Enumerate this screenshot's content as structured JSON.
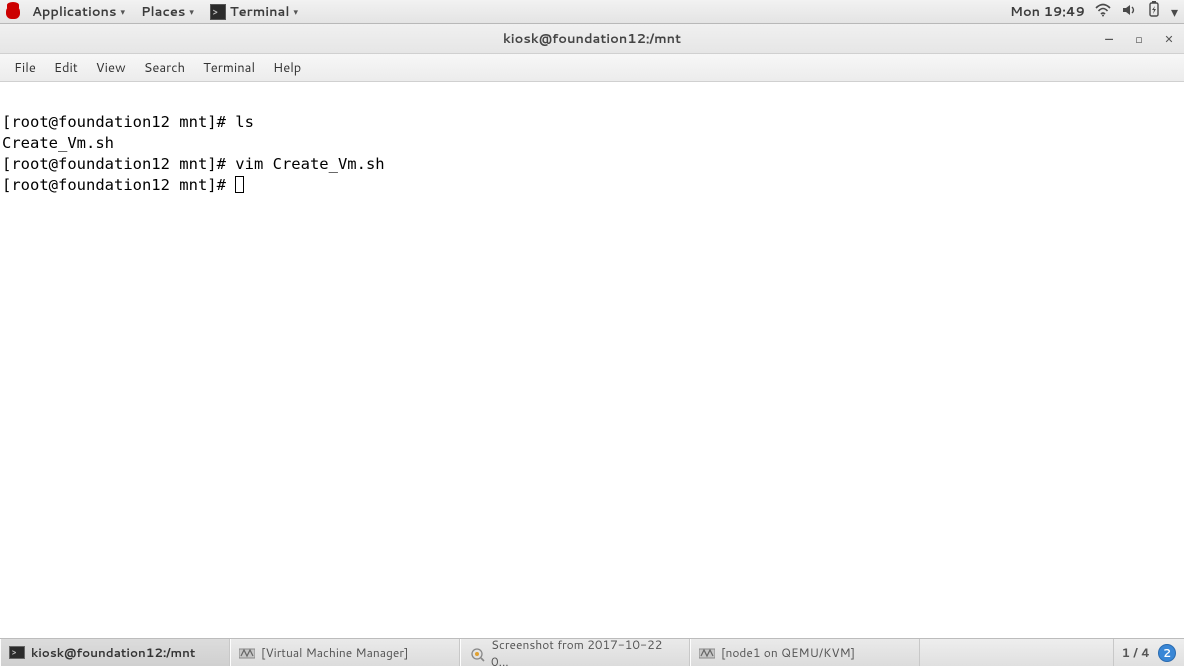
{
  "panel": {
    "applications": "Applications",
    "places": "Places",
    "terminal": "Terminal",
    "clock": "Mon 19:49",
    "icons": {
      "wifi": "wifi-icon",
      "volume": "volume-icon",
      "battery": "battery-icon",
      "dropdown": "▾"
    }
  },
  "window": {
    "title": "kiosk@foundation12:/mnt"
  },
  "menubar": {
    "file": "File",
    "edit": "Edit",
    "view": "View",
    "search": "Search",
    "terminal": "Terminal",
    "help": "Help"
  },
  "terminal": {
    "lines": [
      "[root@foundation12 mnt]# ls",
      "Create_Vm.sh",
      "[root@foundation12 mnt]# vim Create_Vm.sh",
      "[root@foundation12 mnt]# "
    ]
  },
  "taskbar": {
    "items": [
      {
        "label": "kiosk@foundation12:/mnt",
        "active": true
      },
      {
        "label": "[Virtual Machine Manager]",
        "active": false
      },
      {
        "label": "Screenshot from 2017-10-22 0...",
        "active": false
      },
      {
        "label": "[node1 on QEMU/KVM]",
        "active": false
      }
    ],
    "workspace": "1 / 4",
    "notifications": "2"
  }
}
